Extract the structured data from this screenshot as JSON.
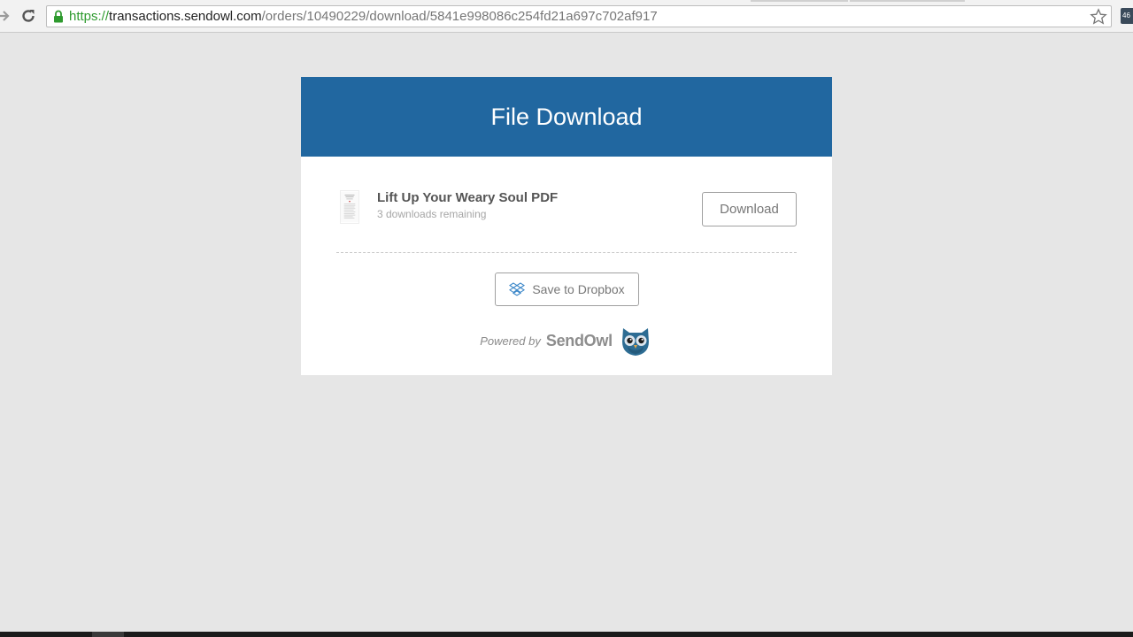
{
  "browser": {
    "url_scheme": "https://",
    "url_host": "transactions.sendowl.com",
    "url_path": "/orders/10490229/download/5841e998086c254fd21a697c702af917",
    "extension_badge": "46"
  },
  "page": {
    "title": "File Download"
  },
  "file": {
    "name": "Lift Up Your Weary Soul PDF",
    "remaining": "3 downloads remaining",
    "download_label": "Download"
  },
  "dropbox": {
    "label": "Save to Dropbox"
  },
  "footer": {
    "powered_by": "Powered by",
    "brand": "SendOwl"
  },
  "colors": {
    "header": "#2167a0",
    "page_background": "#e6e6e6",
    "secure_scheme": "#2e9a2e",
    "owl": "#2d6c93"
  }
}
